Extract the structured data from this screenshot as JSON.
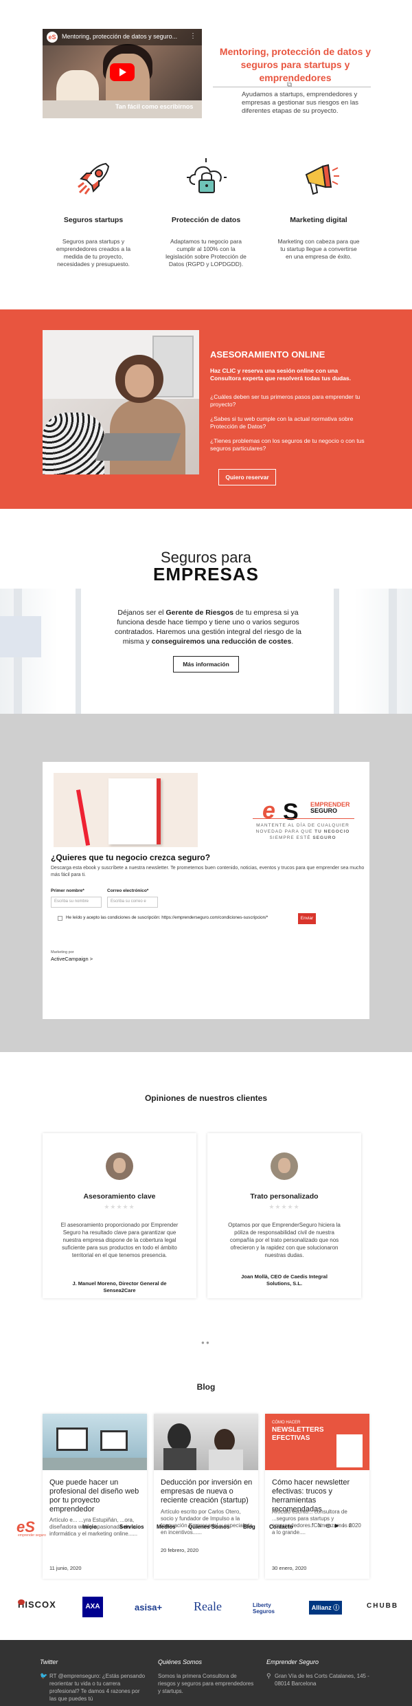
{
  "hero": {
    "video_title": "Mentoring, protección de datos y seguro...",
    "video_caption": "Tan fácil como escribirnos",
    "title": "Mentoring, protección de datos y seguros para startups y emprendedores",
    "text": "Ayudamos a startups, emprendedores y empresas a gestionar sus riesgos en las diferentes etapas de su proyecto."
  },
  "features": [
    {
      "icon": "rocket-icon",
      "title": "Seguros startups",
      "text": "Seguros para startups y emprendedores creados a la medida de tu proyecto, necesidades y presupuesto."
    },
    {
      "icon": "cloud-lock-icon",
      "title": "Protección de datos",
      "text": "Adaptamos tu negocio para cumplir al 100% con la legislación sobre Protección de Datos (RGPD y LOPDGDD)."
    },
    {
      "icon": "megaphone-icon",
      "title": "Marketing digital",
      "text": "Marketing con cabeza para que tu startup llegue a convertirse en una empresa de éxito."
    }
  ],
  "consultoria": {
    "heading": "ASESORAMIENTO ONLINE",
    "lead": "Haz CLIC y reserva una sesión online con una Consultora experta que resolverá todas tus dudas.",
    "q1": "¿Cuáles deben ser tus primeros pasos para emprender tu proyecto?",
    "q2": "¿Sabes si tu web cumple con la actual normativa sobre Protección de Datos?",
    "q3": "¿Tienes problemas con los seguros de tu negocio o con tus seguros particulares?",
    "button": "Quiero reservar"
  },
  "empresas": {
    "title1": "Seguros para",
    "title2": "EMPRESAS",
    "text_a": "Déjanos ser el ",
    "text_b": "Gerente de Riesgos",
    "text_c": " de tu empresa si ya funciona desde hace tiempo y tiene uno o varios seguros contratados. Haremos una gestión integral del riesgo de la misma y ",
    "text_d": "conseguiremos una reducción de costes",
    "text_e": ".",
    "button": "Más información"
  },
  "newsletter": {
    "brand_top": "EMPRENDER",
    "brand_bottom": "SEGURO",
    "tagline_a": "MANTENTE AL DÍA DE CUALQUIER NOVEDAD PARA QUE ",
    "tagline_b": "TU NEGOCIO",
    "tagline_c": " SIEMPRE ESTÉ ",
    "tagline_d": "SEGURO",
    "heading": "¿Quieres que tu negocio crezca seguro?",
    "text": "Descarga esta ebook y suscríbete a nuestra newsletter. Te prometemos buen contenido, noticias, eventos y trucos para que emprender sea mucho más fácil para ti.",
    "name_label": "Primer nombre*",
    "name_placeholder": "Escriba su nombre",
    "email_label": "Correo electrónico*",
    "email_placeholder": "Escriba su correo e",
    "consent": "He leído y acepto las condiciones de suscripción: https://emprenderseguro.com/condiciones-suscripcion/*",
    "submit": "Enviar",
    "marketing_by": "Marketing por",
    "provider": "ActiveCampaign >"
  },
  "testimonials": {
    "heading": "Opiniones de nuestros clientes",
    "items": [
      {
        "title": "Asesoramiento clave",
        "stars": "★★★★★",
        "text": "El asesoramiento proporcionado por Emprender Seguro ha resultado clave para garantizar que nuestra empresa dispone de la cobertura legal suficiente para sus productos en todo el ámbito territorial en el que tenemos presencia.",
        "author": "J. Manuel Moreno, Director General de Sensea2Care"
      },
      {
        "title": "Trato personalizado",
        "stars": "★★★★★",
        "text": "Optamos por que EmprenderSeguro hiciera la póliza de responsabilidad civil de nuestra compañía por el trato personalizado que nos ofrecieron y la rapidez con que solucionaron nuestras dudas.",
        "author": "Joan Mollà, CEO de Caedis Integral Solutions, S.L."
      }
    ],
    "dots": "● ●"
  },
  "blog": {
    "heading": "Blog",
    "posts": [
      {
        "title": "Que puede hacer un profesional del diseño web por tu proyecto emprendedor",
        "text": "Artículo e... ...yra Estupiñán, ...ora, diseñadora web y apasionada de la informática y el marketing online......",
        "date": "11 junio, 2020"
      },
      {
        "title": "Deducción por inversión en empresas de nueva o reciente creación (startup)",
        "text": "Artículo escrito por Carlos Otero, socio y fundador de Impulso a la Innovación Empresarial y especialista en incentivos......",
        "date": "20 febrero, 2020"
      },
      {
        "title": "Cómo hacer newsletter efectivas: trucos y herramientas recomendadas",
        "text": "Artículo escrito... consultora de ...seguros para startups y emprendedores. Comenzamos 2020 a lo grande....",
        "date": "30 enero, 2020"
      }
    ],
    "img_badge_top": "CÓMO HACER",
    "img_badge_mid": "NEWSLETTERS",
    "img_badge_bot": "EFECTIVAS"
  },
  "sticky_nav": {
    "logo": "eS",
    "brand": "emprender seguro",
    "items": [
      "Inicio",
      "Servicios",
      "Medios",
      "Quienes Somos",
      "Blog",
      "Contacto"
    ]
  },
  "partners": [
    "HISCOX",
    "AXA",
    "asisa+",
    "Reale",
    "Liberty Seguros",
    "Allianz ⓘ",
    "CHUBB"
  ],
  "footer": {
    "twitter_h": "Twitter",
    "tweet": "RT @emprenseguro: ¿Estás pensando reorientar tu vida o tu carrera profesional? Te damos 4 razones por las que puedes tú",
    "about_h": "Quiénes Somos",
    "about": "Somos la primera Consultora de riesgos y seguros para emprendedores y startups.",
    "contact_h": "Emprender Seguro",
    "address": "Gran Vía de les Corts Catalanes, 145 - 08014 Barcelona"
  },
  "colors": {
    "accent": "#e8553f",
    "footer": "#333333",
    "grey_band": "#cfcfcf"
  }
}
